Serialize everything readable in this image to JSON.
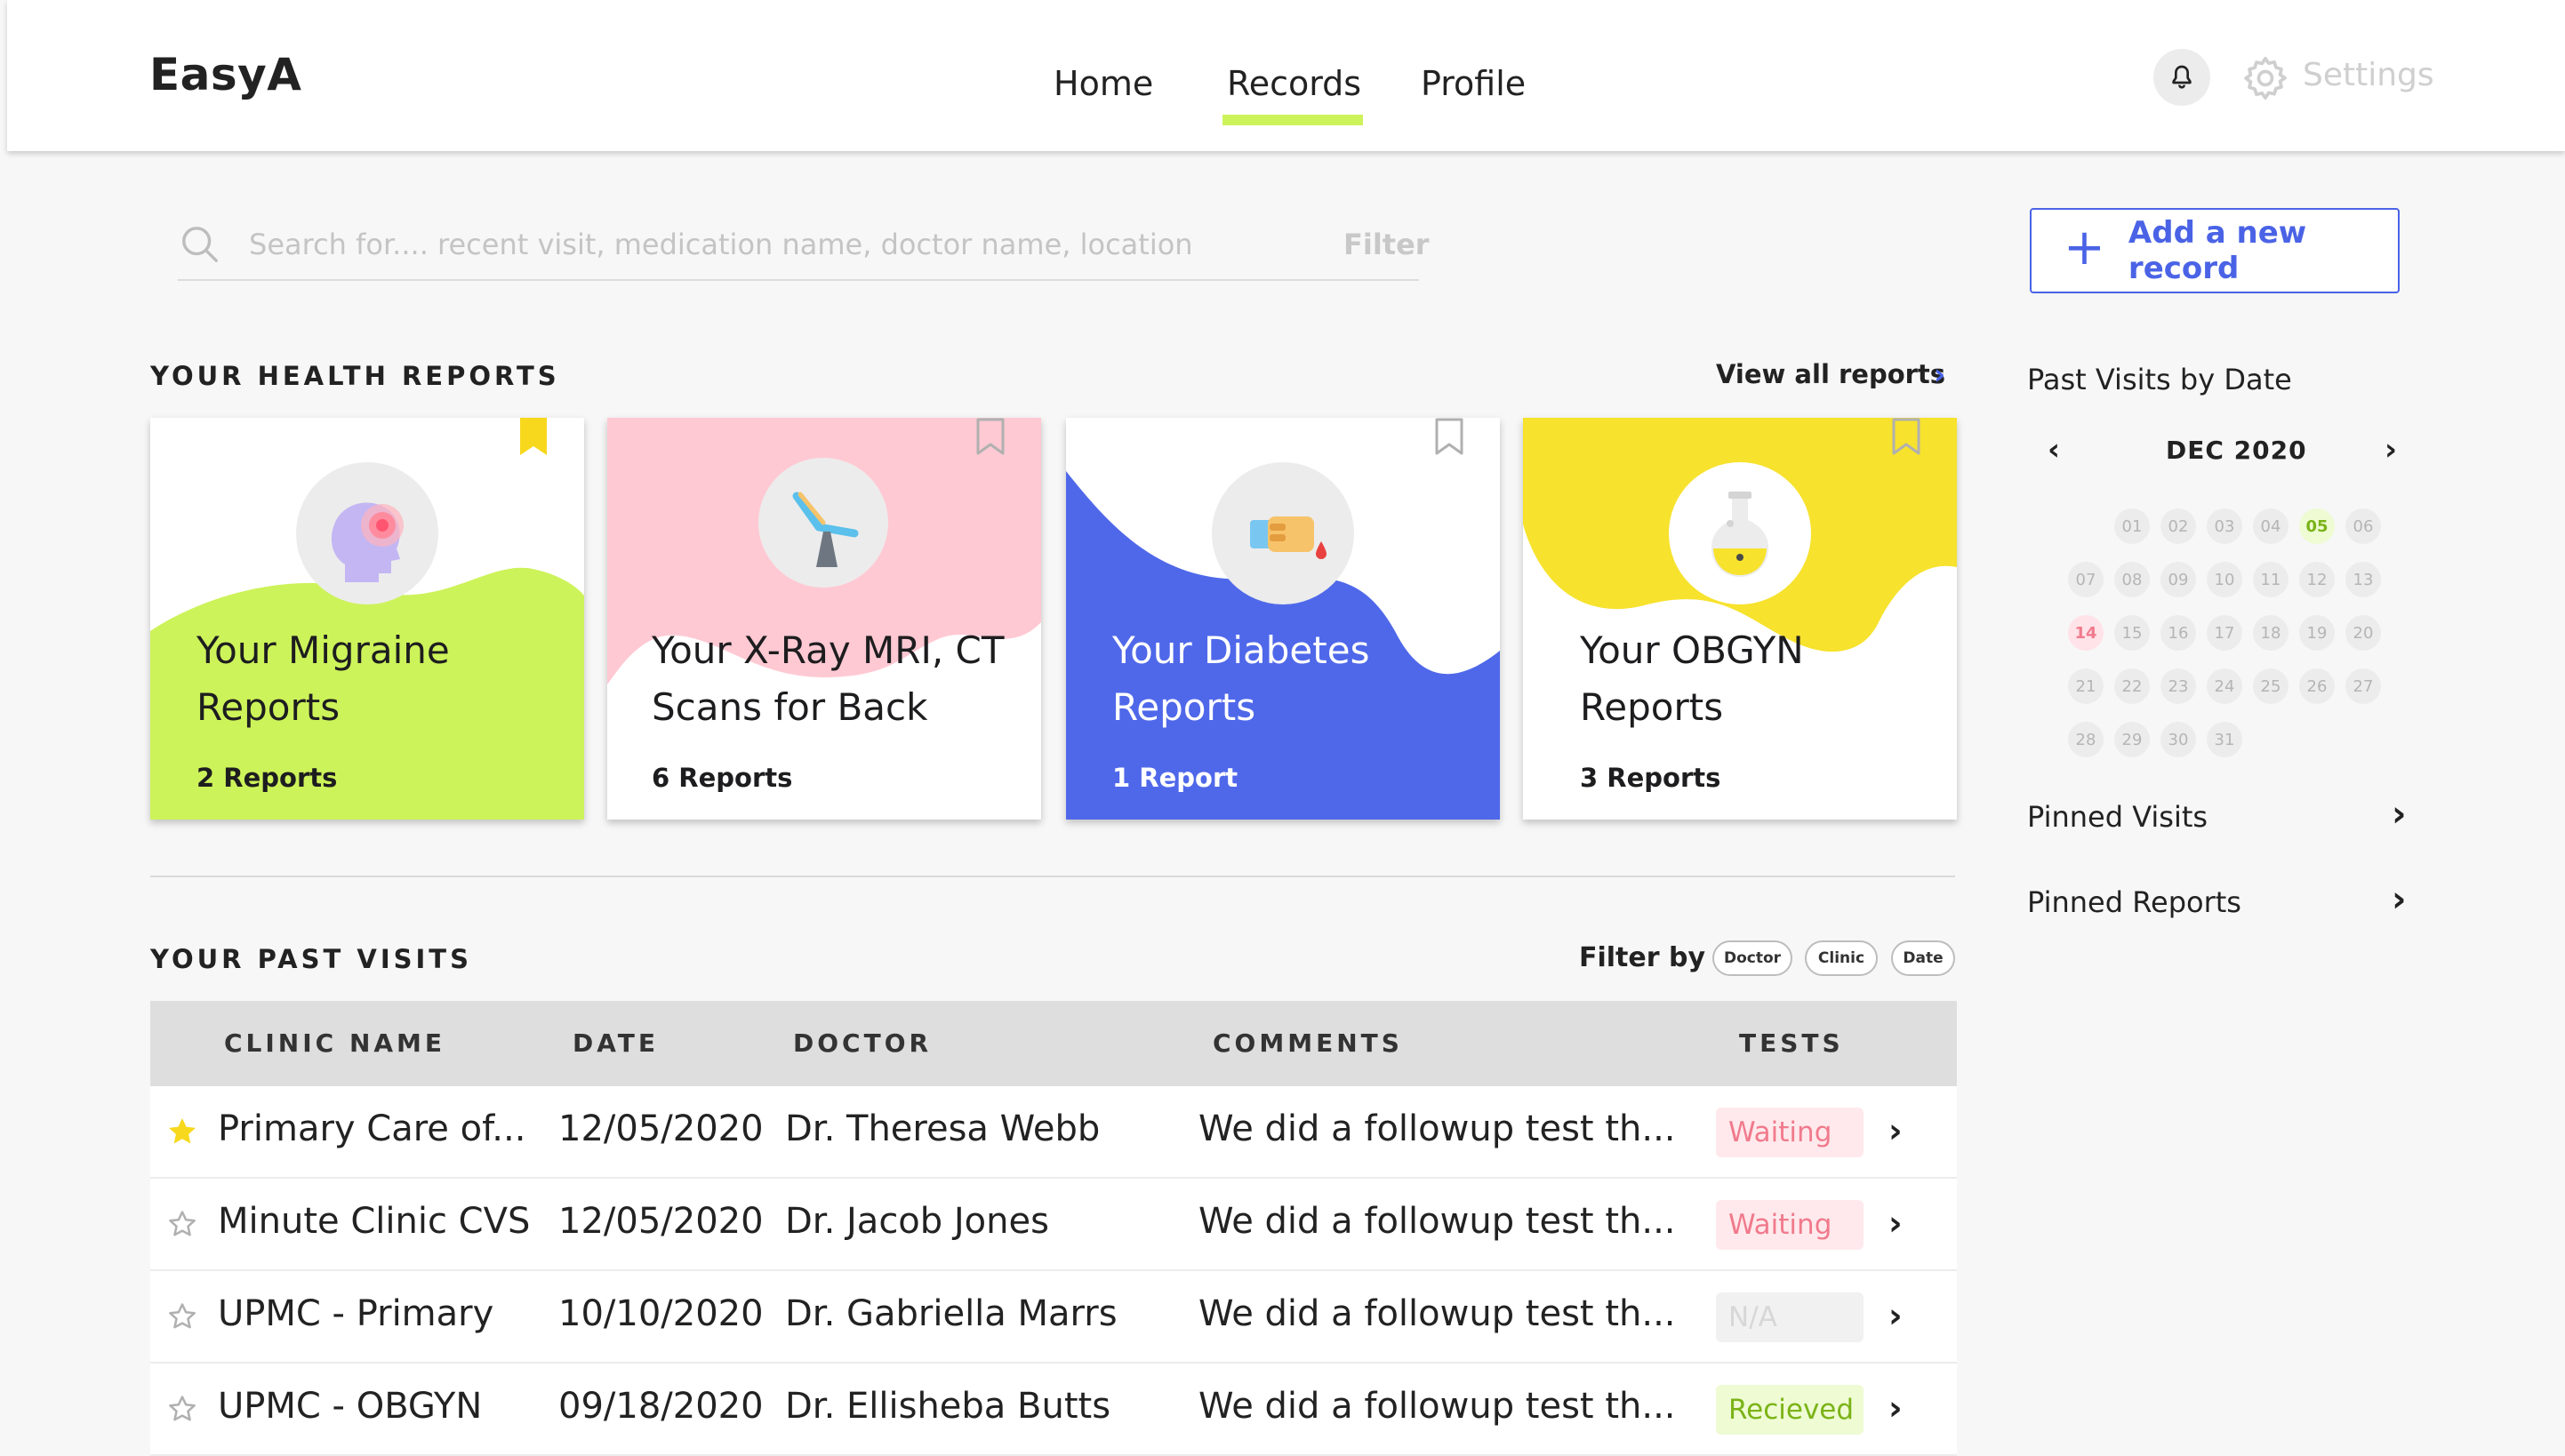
{
  "app": {
    "name": "EasyA"
  },
  "nav": {
    "home": "Home",
    "records": "Records",
    "profile": "Profile",
    "settings": "Settings"
  },
  "search": {
    "placeholder": "Search for.... recent visit, medication name, doctor name, location",
    "filter": "Filter"
  },
  "actions": {
    "add_record": "Add a new record"
  },
  "health_reports": {
    "title": "YOUR HEALTH REPORTS",
    "view_all": "View all reports",
    "cards": [
      {
        "title": "Your Migraine Reports",
        "count": "2 Reports",
        "bookmarked": true,
        "color": "#cdf35a"
      },
      {
        "title": "Your X-Ray MRI, CT Scans for Back",
        "count": "6 Reports",
        "bookmarked": false,
        "color": "#ffc9d3"
      },
      {
        "title": "Your Diabetes Reports",
        "count": "1 Report",
        "bookmarked": false,
        "color": "#4f68ea"
      },
      {
        "title": "Your OBGYN Reports",
        "count": "3 Reports",
        "bookmarked": false,
        "color": "#f7e22d"
      }
    ]
  },
  "past_visits": {
    "title": "YOUR PAST VISITS",
    "filter_by": "Filter by",
    "filters": [
      "Doctor",
      "Clinic",
      "Date"
    ],
    "columns": [
      "CLINIC NAME",
      "DATE",
      "DOCTOR",
      "COMMENTS",
      "TESTS"
    ],
    "rows": [
      {
        "clinic": "Primary Care of...",
        "date": "12/05/2020",
        "doctor": "Dr. Theresa Webb",
        "comment": "We did a followup test th...",
        "test": "Waiting",
        "starred": true
      },
      {
        "clinic": "Minute Clinic CVS",
        "date": "12/05/2020",
        "doctor": "Dr. Jacob Jones",
        "comment": "We did a followup test th...",
        "test": "Waiting",
        "starred": false
      },
      {
        "clinic": "UPMC - Primary",
        "date": "10/10/2020",
        "doctor": "Dr. Gabriella Marrs",
        "comment": "We did a followup test th...",
        "test": "N/A",
        "starred": false
      },
      {
        "clinic": "UPMC - OBGYN",
        "date": "09/18/2020",
        "doctor": "Dr. Ellisheba Butts",
        "comment": "We did a followup test th...",
        "test": "Recieved",
        "starred": false
      }
    ]
  },
  "sidebar": {
    "past_visits_title": "Past Visits by Date",
    "calendar": {
      "month": "DEC 2020",
      "days": [
        "01",
        "02",
        "03",
        "04",
        "05",
        "06",
        "07",
        "08",
        "09",
        "10",
        "11",
        "12",
        "13",
        "14",
        "15",
        "16",
        "17",
        "18",
        "19",
        "20",
        "21",
        "22",
        "23",
        "24",
        "25",
        "26",
        "27",
        "28",
        "29",
        "30",
        "31"
      ],
      "highlighted_green": "05",
      "highlighted_red": "14"
    },
    "pinned_visits": "Pinned Visits",
    "pinned_reports": "Pinned Reports"
  },
  "colors": {
    "accent": "#4a63e6",
    "lime": "#cdf35a",
    "waiting_bg": "#ffe9ec",
    "waiting_text": "#f07a8c",
    "received_bg": "#eefbd3",
    "received_text": "#7bb317",
    "na_bg": "#f1f1f1",
    "na_text": "#d7d7d7"
  }
}
